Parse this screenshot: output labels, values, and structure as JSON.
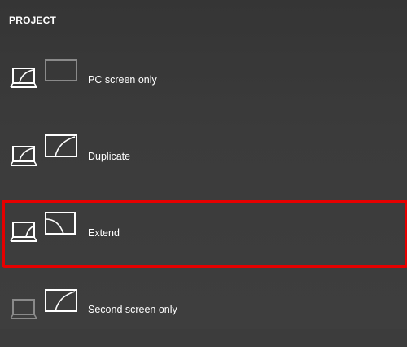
{
  "header": {
    "title": "PROJECT"
  },
  "options": [
    {
      "label": "PC screen only",
      "icon": "pc-screen-only-icon"
    },
    {
      "label": "Duplicate",
      "icon": "duplicate-icon"
    },
    {
      "label": "Extend",
      "icon": "extend-icon",
      "highlighted": true
    },
    {
      "label": "Second screen only",
      "icon": "second-screen-only-icon"
    }
  ],
  "colors": {
    "background": "#3c3c3c",
    "text": "#ffffff",
    "icon_active": "#ffffff",
    "icon_dim": "#8a8a8a",
    "highlight": "#e60000"
  }
}
